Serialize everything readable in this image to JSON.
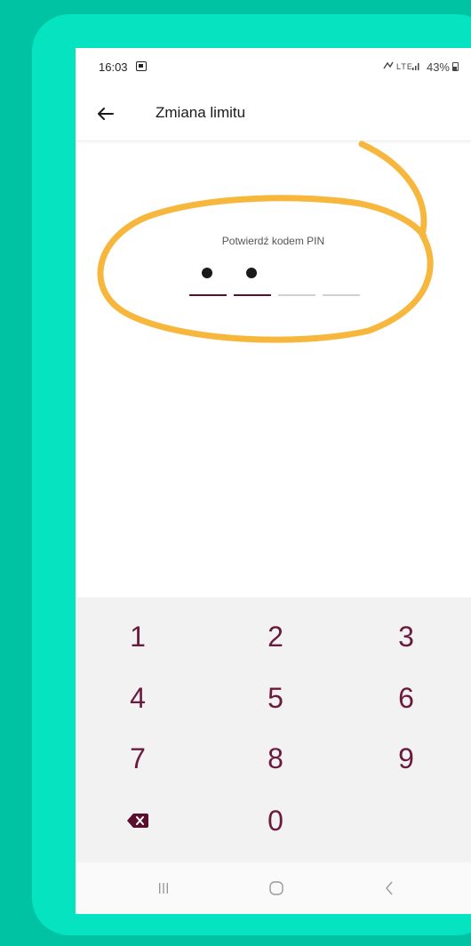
{
  "statusbar": {
    "time": "16:03",
    "icons_text": "≋ ·∙∣ 43%",
    "battery": "43%"
  },
  "appbar": {
    "title": "Zmiana limitu",
    "back_icon": "arrow-left-icon"
  },
  "pin": {
    "label": "Potwierdź kodem PIN",
    "total_digits": 4,
    "entered_digits": 2
  },
  "keypad": {
    "keys": [
      "1",
      "2",
      "3",
      "4",
      "5",
      "6",
      "7",
      "8",
      "9",
      "0"
    ],
    "backspace_icon": "backspace-icon"
  },
  "navbar": {
    "recents_icon": "recents-icon",
    "home_icon": "home-icon",
    "back_icon": "nav-back-icon"
  },
  "colors": {
    "background": "#00c3a4",
    "frame": "#06e3c0",
    "accent": "#6b1a3d",
    "annotation": "#f6b73c"
  }
}
